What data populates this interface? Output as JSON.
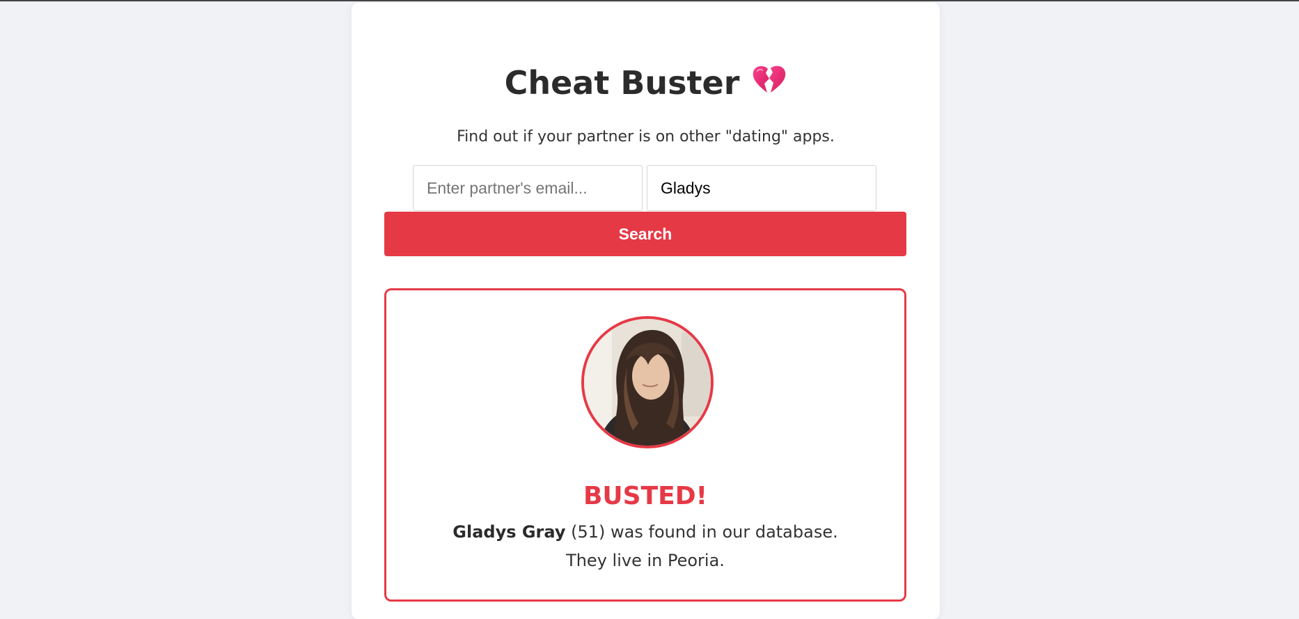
{
  "app": {
    "title": "Cheat Buster",
    "title_icon": "broken-heart-icon",
    "subtitle": "Find out if your partner is on other \"dating\" apps."
  },
  "search": {
    "email_placeholder": "Enter partner's email...",
    "email_value": "",
    "name_value": "Gladys",
    "button_label": "Search"
  },
  "result": {
    "status": "BUSTED!",
    "name": "Gladys Gray",
    "age": "(51)",
    "found_text": "was found in our database.",
    "location_text": "They live in Peoria.",
    "avatar_icon": "profile-photo"
  },
  "colors": {
    "accent": "#e63946",
    "background": "#f0f2f5",
    "card": "#ffffff"
  }
}
